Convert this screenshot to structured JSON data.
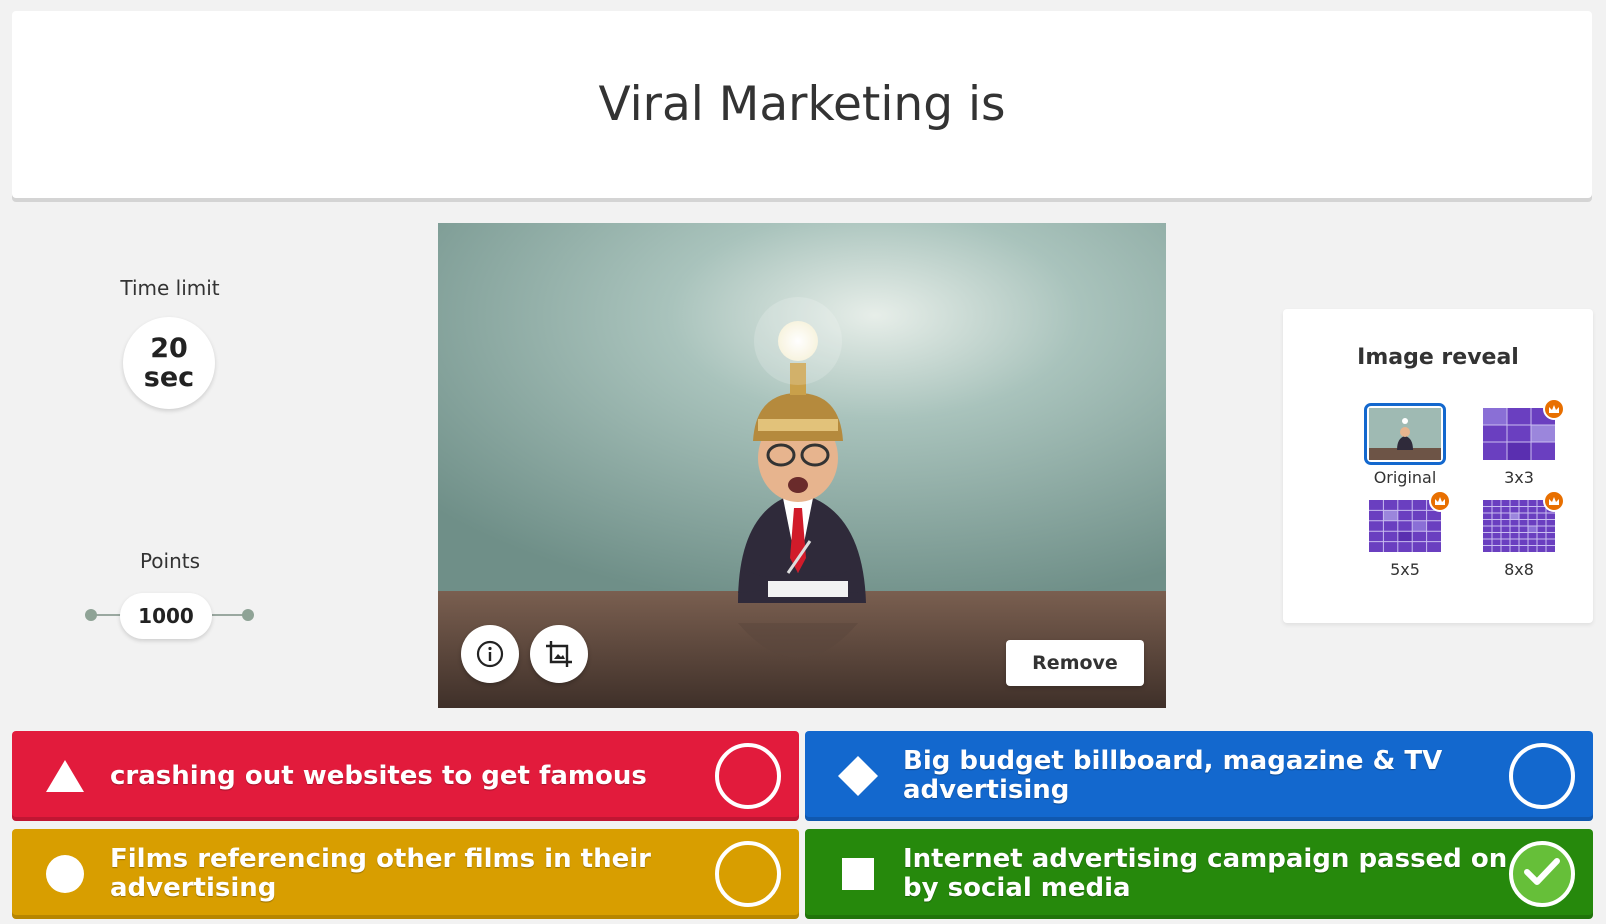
{
  "question": {
    "title": "Viral Marketing is"
  },
  "settings": {
    "time_limit_label": "Time limit",
    "time_value": "20",
    "time_unit": "sec",
    "points_label": "Points",
    "points_value": "1000"
  },
  "image": {
    "remove_label": "Remove",
    "info_icon": "info-icon",
    "crop_icon": "crop-icon"
  },
  "image_reveal": {
    "title": "Image reveal",
    "options": [
      {
        "label": "Original",
        "selected": true,
        "premium": false
      },
      {
        "label": "3x3",
        "selected": false,
        "premium": true
      },
      {
        "label": "5x5",
        "selected": false,
        "premium": true
      },
      {
        "label": "8x8",
        "selected": false,
        "premium": true
      }
    ]
  },
  "answers": [
    {
      "text": "crashing out websites to get famous",
      "shape": "triangle",
      "color": "#e21b3c",
      "correct": false
    },
    {
      "text": "Big budget billboard, magazine & TV advertising",
      "shape": "diamond",
      "color": "#1368ce",
      "correct": false
    },
    {
      "text": "Films referencing other films in their advertising",
      "shape": "circle",
      "color": "#d89e00",
      "correct": false
    },
    {
      "text": "Internet advertising campaign passed on by social media",
      "shape": "square",
      "color": "#26890c",
      "correct": true
    }
  ],
  "colors": {
    "correct_check": "#66bf39",
    "selected_outline": "#1368ce",
    "premium_badge": "#e86f00"
  }
}
